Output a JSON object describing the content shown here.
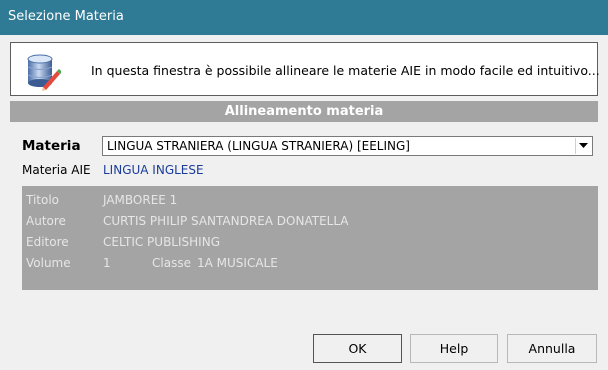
{
  "window": {
    "title": "Selezione Materia"
  },
  "info": {
    "icon": "database-edit-icon",
    "text": "In questa finestra è possibile allineare le materie AIE in modo facile ed intuitivo..."
  },
  "section": {
    "header": "Allineamento materia"
  },
  "form": {
    "materia_label": "Materia",
    "materia_value": "LINGUA STRANIERA (LINGUA STRANIERA) [EELING]",
    "aie_label": "Materia AIE",
    "aie_value": "LINGUA INGLESE"
  },
  "details": {
    "titolo_label": "Titolo",
    "titolo_value": "JAMBOREE 1",
    "autore_label": "Autore",
    "autore_value": "CURTIS PHILIP SANTANDREA DONATELLA",
    "editore_label": "Editore",
    "editore_value": "CELTIC PUBLISHING",
    "volume_label": "Volume",
    "volume_value": "1",
    "classe_label": "Classe",
    "classe_value": "1A MUSICALE"
  },
  "buttons": {
    "ok": "OK",
    "help": "Help",
    "annulla": "Annulla"
  },
  "colors": {
    "titlebar": "#2f7a94",
    "section": "#a4a4a4",
    "aie_value": "#1a3c9a"
  }
}
